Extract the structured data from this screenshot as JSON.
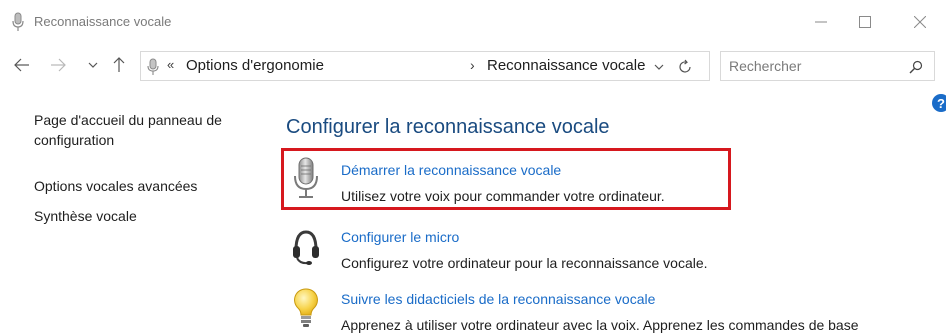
{
  "window": {
    "title": "Reconnaissance vocale"
  },
  "navbar": {
    "address_overflow": "«",
    "breadcrumb": [
      "Options d'ergonomie",
      "Reconnaissance vocale"
    ],
    "separator": "›",
    "search_placeholder": "Rechercher"
  },
  "help": {
    "label": "?"
  },
  "sidebar": {
    "items": [
      {
        "label": "Page d'accueil du panneau de configuration"
      },
      {
        "label": "Options vocales avancées"
      },
      {
        "label": "Synthèse vocale"
      }
    ]
  },
  "main": {
    "title": "Configurer la reconnaissance vocale",
    "tasks": [
      {
        "icon": "microphone-icon",
        "link": "Démarrer la reconnaissance vocale",
        "description": "Utilisez votre voix pour commander votre ordinateur.",
        "highlighted": true
      },
      {
        "icon": "headset-icon",
        "link": "Configurer le micro",
        "description": "Configurez votre ordinateur pour la reconnaissance vocale."
      },
      {
        "icon": "lightbulb-icon",
        "link": "Suivre les didacticiels de la reconnaissance vocale",
        "description": "Apprenez à utiliser votre ordinateur avec la voix. Apprenez les commandes de base"
      }
    ]
  },
  "colors": {
    "link": "#1a6cc8",
    "title": "#1a4b80",
    "highlight_border": "#d6181e",
    "help_badge": "#1a6cc8"
  }
}
